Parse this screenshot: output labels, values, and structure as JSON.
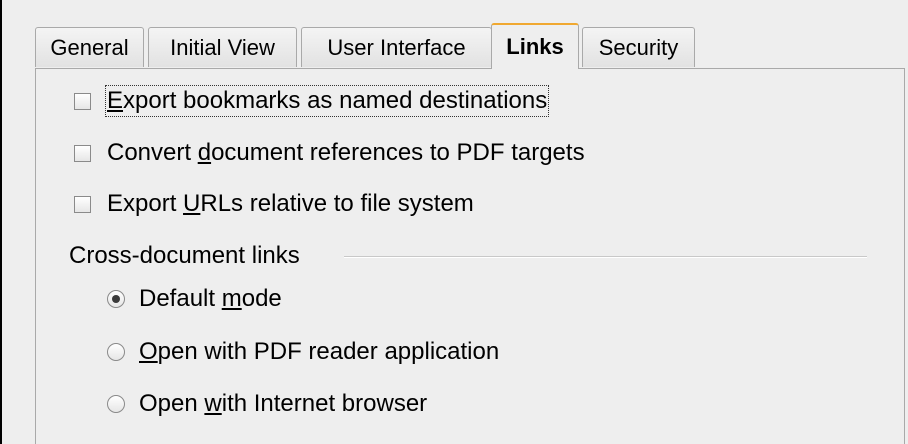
{
  "tabs": [
    {
      "label": "General"
    },
    {
      "label": "Initial View"
    },
    {
      "label": "User Interface"
    },
    {
      "label": "Links",
      "active": true
    },
    {
      "label": "Security"
    }
  ],
  "checkboxes": [
    {
      "mnemonic": "E",
      "pre": "",
      "post": "xport bookmarks as named destinations",
      "checked": false
    },
    {
      "pre": "Convert ",
      "mnemonic": "d",
      "post": "ocument references to PDF targets",
      "checked": false
    },
    {
      "pre": "Export ",
      "mnemonic": "U",
      "post": "RLs relative to file system",
      "checked": false
    }
  ],
  "cross_document_links": {
    "label": "Cross-document links",
    "options": [
      {
        "pre": "Default ",
        "mnemonic": "m",
        "post": "ode",
        "selected": true
      },
      {
        "pre": "",
        "mnemonic": "O",
        "post": "pen with PDF reader application",
        "selected": false
      },
      {
        "pre": "Open ",
        "mnemonic": "w",
        "post": "ith Internet browser",
        "selected": false
      }
    ]
  },
  "colors": {
    "active_tab_accent": "#f0a830",
    "dialog_background": "#eeeeee",
    "border": "#a9a9a9"
  }
}
